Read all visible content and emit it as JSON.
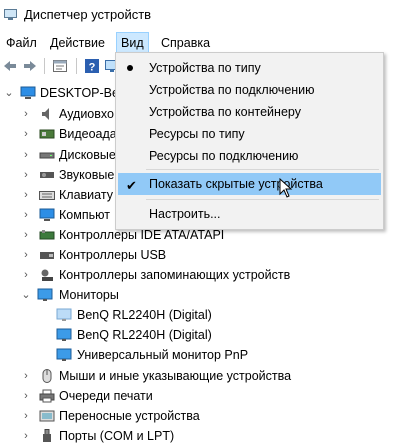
{
  "window": {
    "title": "Диспетчер устройств"
  },
  "menubar": {
    "items": [
      {
        "label": "Файл"
      },
      {
        "label": "Действие"
      },
      {
        "label": "Вид"
      },
      {
        "label": "Справка"
      }
    ]
  },
  "toolbar": {
    "buttons": [
      "back-arrow-icon",
      "forward-arrow-icon",
      "properties-icon",
      "help-icon"
    ]
  },
  "tree": {
    "root": "DESKTOP-Be",
    "categories": [
      {
        "label": "Аудиовхо",
        "icon": "speaker-icon",
        "expanded": false
      },
      {
        "label": "Видеоада",
        "icon": "display-adapter-icon",
        "expanded": false
      },
      {
        "label": "Дисковые",
        "icon": "disk-drive-icon",
        "expanded": false
      },
      {
        "label": "Звуковые",
        "icon": "sound-icon",
        "expanded": false
      },
      {
        "label": "Клавиату",
        "icon": "keyboard-icon",
        "expanded": false
      },
      {
        "label": "Компьют",
        "icon": "computer-icon",
        "expanded": false
      },
      {
        "label": "Контроллеры IDE ATA/ATAPI",
        "icon": "controller-icon",
        "expanded": false
      },
      {
        "label": "Контроллеры USB",
        "icon": "usb-icon",
        "expanded": false
      },
      {
        "label": "Контроллеры запоминающих устройств",
        "icon": "storage-controller-icon",
        "expanded": false
      },
      {
        "label": "Мониторы",
        "icon": "monitor-icon",
        "expanded": true
      },
      {
        "label": "BenQ RL2240H (Digital)",
        "icon": "monitor-icon",
        "child": true,
        "disabled": true
      },
      {
        "label": "BenQ RL2240H (Digital)",
        "icon": "monitor-icon",
        "child": true,
        "disabled": false
      },
      {
        "label": "Универсальный монитор PnP",
        "icon": "monitor-icon",
        "child": true,
        "disabled": false
      },
      {
        "label": "Мыши и иные указывающие устройства",
        "icon": "mouse-icon",
        "expanded": false
      },
      {
        "label": "Очереди печати",
        "icon": "printer-icon",
        "expanded": false
      },
      {
        "label": "Переносные устройства",
        "icon": "portable-device-icon",
        "expanded": false
      },
      {
        "label": "Порты (COM и LPT)",
        "icon": "port-icon",
        "expanded": false
      }
    ]
  },
  "view_menu": {
    "items": [
      {
        "label": "Устройства по типу",
        "marker": "bullet"
      },
      {
        "label": "Устройства по подключению",
        "marker": ""
      },
      {
        "label": "Устройства по контейнеру",
        "marker": ""
      },
      {
        "label": "Ресурсы по типу",
        "marker": ""
      },
      {
        "label": "Ресурсы по подключению",
        "marker": ""
      },
      {
        "label": "Показать скрытые устройства",
        "marker": "check",
        "highlighted": true
      },
      {
        "label": "Настроить...",
        "marker": ""
      }
    ]
  },
  "colors": {
    "menu_highlight": "#91c9f7",
    "menubar_active": "#cce8ff",
    "monitor_blue": "#3c9be8"
  }
}
